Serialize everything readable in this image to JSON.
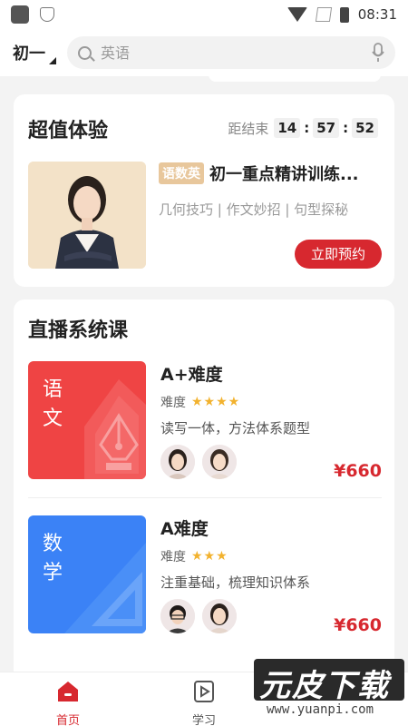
{
  "status_bar": {
    "time": "08:31"
  },
  "header": {
    "grade": "初一",
    "search_placeholder": "英语"
  },
  "promo": {
    "title": "超值体验",
    "countdown_label": "距结束",
    "hours": "14",
    "minutes": "57",
    "seconds": "52",
    "tag": "语数英",
    "course_title": "初一重点精讲训练...",
    "subtitle": "几何技巧 | 作文妙招 | 句型探秘",
    "button": "立即预约"
  },
  "live": {
    "title": "直播系统课",
    "courses": [
      {
        "cover_label": "语文",
        "cover_color": "#ef4444",
        "name": "A+难度",
        "difficulty_label": "难度",
        "stars": "★★★★",
        "desc": "读写一体，方法体系题型",
        "price": "¥660"
      },
      {
        "cover_label": "数学",
        "cover_color": "#3b82f6",
        "name": "A难度",
        "difficulty_label": "难度",
        "stars": "★★★",
        "desc": "注重基础，梳理知识体系",
        "price": "¥660"
      }
    ]
  },
  "tabs": [
    {
      "label": "首页",
      "icon": "home-icon",
      "active": true
    },
    {
      "label": "学习",
      "icon": "play-icon",
      "active": false
    }
  ],
  "watermark": {
    "text": "元皮下载",
    "url": "www.yuanpi.com"
  }
}
